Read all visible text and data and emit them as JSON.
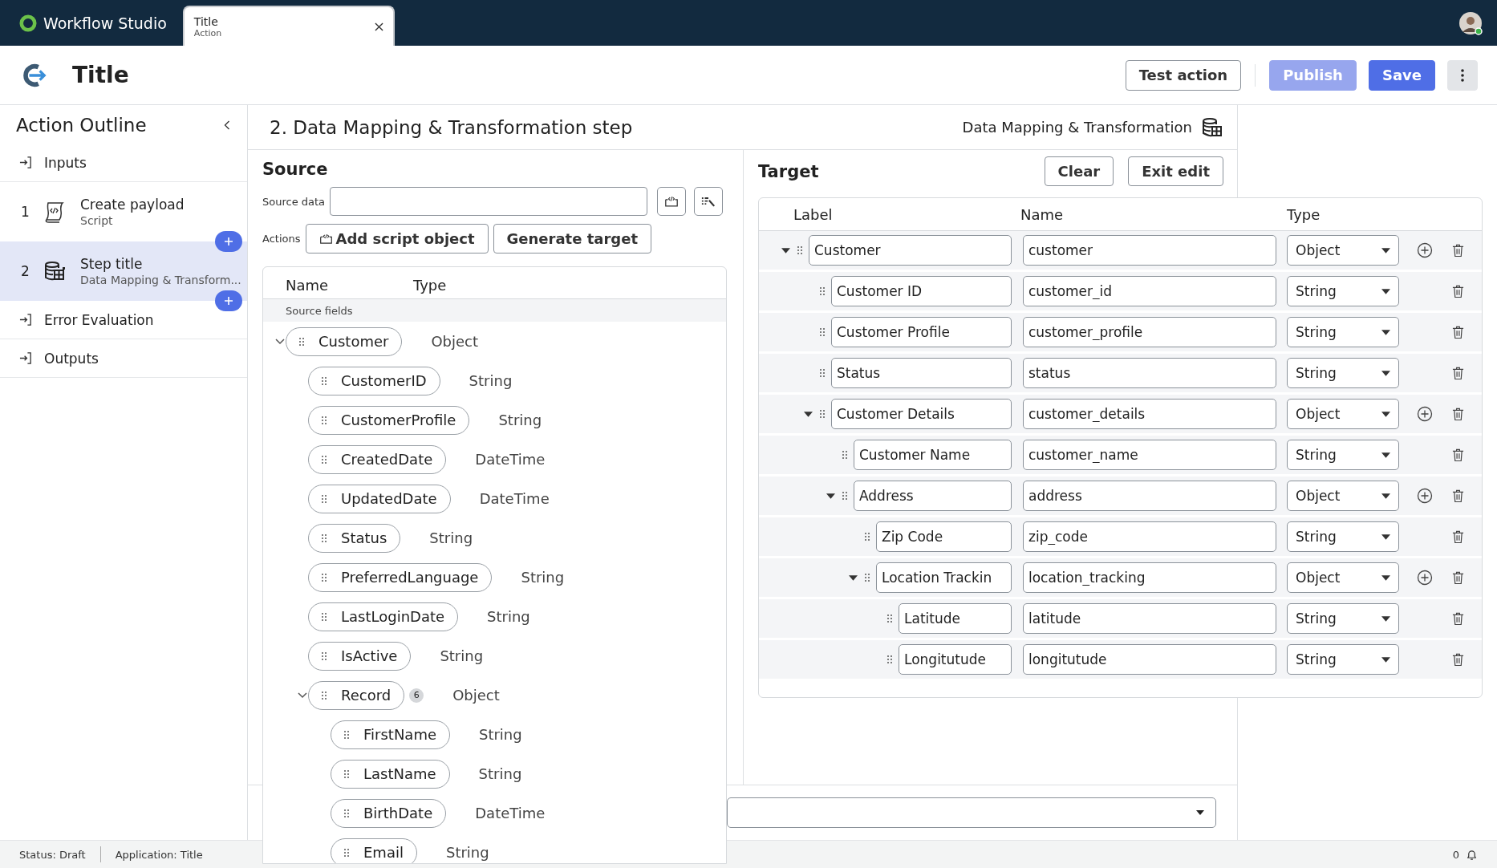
{
  "app": {
    "name": "Workflow Studio"
  },
  "tabs": [
    {
      "title": "Title",
      "subtitle": "Action",
      "selected": true
    }
  ],
  "header": {
    "title": "Title",
    "buttons": [
      {
        "label": "Test action",
        "kind": "outline",
        "disabled": false
      },
      {
        "label": "Publish",
        "kind": "primary",
        "disabled": true
      },
      {
        "label": "Save",
        "kind": "primary",
        "disabled": false
      }
    ]
  },
  "sidebar": {
    "title": "Action Outline",
    "items": [
      {
        "kind": "section",
        "label": "Inputs",
        "selected": false
      },
      {
        "kind": "script_step",
        "number": "1",
        "label": "Create payload",
        "sublabel": "Script",
        "selected": false
      },
      {
        "kind": "mapping_step",
        "number": "2",
        "label": "Step title",
        "sublabel": "Data Mapping & Transform...",
        "selected": true
      },
      {
        "kind": "section",
        "label": "Error Evaluation",
        "selected": false
      },
      {
        "kind": "section",
        "label": "Outputs",
        "selected": false
      }
    ]
  },
  "step": {
    "title": "2. Data Mapping & Transformation step",
    "type_label": "Data Mapping & Transformation"
  },
  "source": {
    "title": "Source",
    "source_data_label": "Source data",
    "actions_label": "Actions",
    "action_buttons": [
      {
        "label": "Add script object",
        "kind": "script"
      },
      {
        "label": "Generate target",
        "kind": "plain"
      }
    ],
    "columns": [
      "Name",
      "Type"
    ],
    "group_label": "Source fields",
    "fields": [
      {
        "name": "Customer",
        "type": "Object",
        "expanded": true,
        "children": [
          {
            "name": "CustomerID",
            "type": "String"
          },
          {
            "name": "CustomerProfile",
            "type": "String"
          },
          {
            "name": "CreatedDate",
            "type": "DateTime"
          },
          {
            "name": "UpdatedDate",
            "type": "DateTime"
          },
          {
            "name": "Status",
            "type": "String"
          },
          {
            "name": "PreferredLanguage",
            "type": "String"
          },
          {
            "name": "LastLoginDate",
            "type": "String"
          },
          {
            "name": "IsActive",
            "type": "String"
          },
          {
            "name": "Record",
            "type": "Object",
            "count": "6",
            "expanded": true,
            "children": [
              {
                "name": "FirstName",
                "type": "String"
              },
              {
                "name": "LastName",
                "type": "String"
              },
              {
                "name": "BirthDate",
                "type": "DateTime"
              },
              {
                "name": "Email",
                "type": "String"
              }
            ]
          }
        ]
      }
    ]
  },
  "target": {
    "title": "Target",
    "buttons": [
      "Clear",
      "Exit edit"
    ],
    "columns": [
      "Label",
      "Name",
      "Type"
    ],
    "rows": [
      {
        "label": "Customer",
        "name": "customer",
        "type": "Object",
        "expanded": true,
        "children": [
          {
            "label": "Customer ID",
            "name": "customer_id",
            "type": "String"
          },
          {
            "label": "Customer Profile",
            "name": "customer_profile",
            "type": "String"
          },
          {
            "label": "Status",
            "name": "status",
            "type": "String"
          },
          {
            "label": "Customer Details",
            "name": "customer_details",
            "type": "Object",
            "expanded": true,
            "children": [
              {
                "label": "Customer Name",
                "name": "customer_name",
                "type": "String"
              },
              {
                "label": "Address",
                "name": "address",
                "type": "Object",
                "expanded": true,
                "children": [
                  {
                    "label": "Zip Code",
                    "name": "zip_code",
                    "type": "String"
                  },
                  {
                    "label": "Location Trackin",
                    "name": "location_tracking",
                    "type": "Object",
                    "expanded": true,
                    "children": [
                      {
                        "label": "Latitude",
                        "name": "latitude",
                        "type": "String"
                      },
                      {
                        "label": "Longitutude",
                        "name": "longitutude",
                        "type": "String"
                      }
                    ]
                  }
                ]
              }
            ]
          }
        ]
      }
    ]
  },
  "status_bar": {
    "items": [
      "Status: Draft",
      "Application: Title"
    ],
    "notifications": "0"
  }
}
